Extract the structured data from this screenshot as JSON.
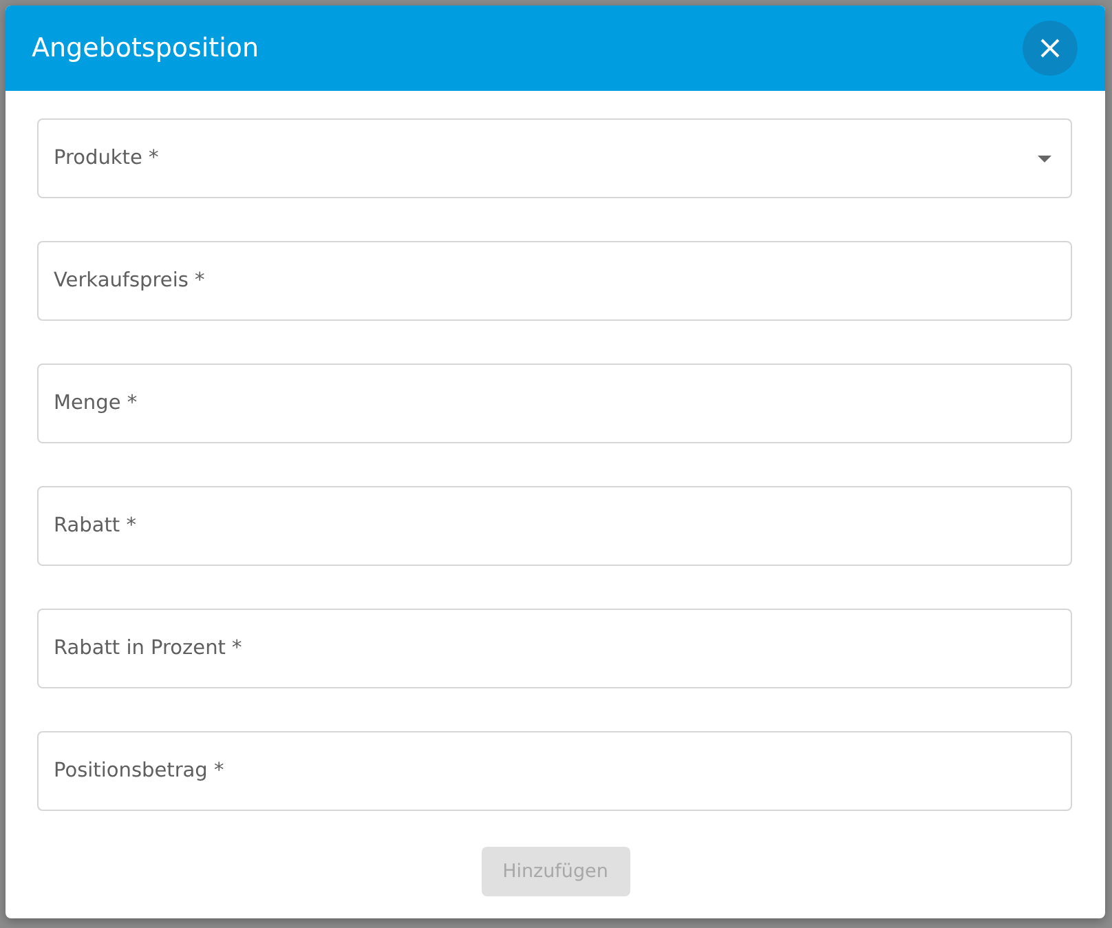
{
  "dialog": {
    "title": "Angebotsposition",
    "fields": [
      {
        "label": "Produkte *",
        "kind": "select"
      },
      {
        "label": "Verkaufspreis *",
        "kind": "text"
      },
      {
        "label": "Menge *",
        "kind": "text"
      },
      {
        "label": "Rabatt *",
        "kind": "text"
      },
      {
        "label": "Rabatt in Prozent *",
        "kind": "text"
      },
      {
        "label": "Positionsbetrag *",
        "kind": "text"
      }
    ],
    "submit": {
      "label": "Hinzufügen",
      "disabled": true
    }
  }
}
